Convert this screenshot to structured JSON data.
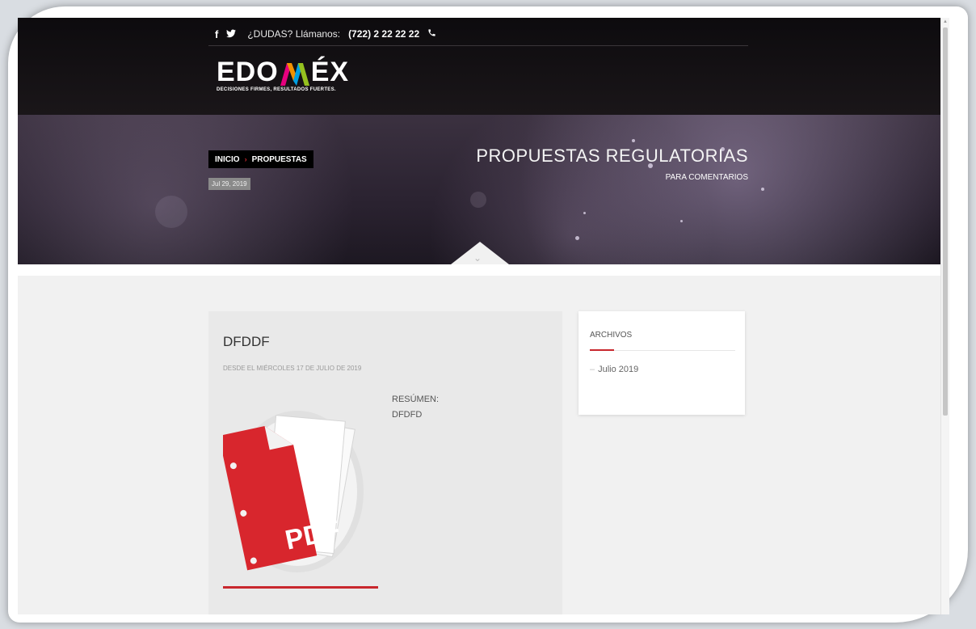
{
  "header": {
    "social_facebook": "f",
    "social_twitter": "𝕥",
    "contact_prompt": "¿DUDAS? Llámanos:",
    "phone": "(722) 2 22 22 22",
    "logo_text_left": "EDO",
    "logo_text_right": "ÉX",
    "logo_tagline": "DECISIONES FIRMES, RESULTADOS FUERTES."
  },
  "hero": {
    "breadcrumb_home": "INICIO",
    "breadcrumb_current": "PROPUESTAS",
    "date": "Jul 29, 2019",
    "title": "PROPUESTAS REGULATORIAS",
    "subtitle": "PARA COMENTARIOS"
  },
  "post": {
    "title": "DFDDF",
    "date_line": "DESDE EL MIÉRCOLES 17 DE JULIO DE 2019",
    "resumen_label": "RESÚMEN:",
    "resumen_text": "DFDFD",
    "pdf_label": "PDF"
  },
  "sidebar": {
    "title": "ARCHIVOS",
    "items": [
      "Julio 2019"
    ]
  },
  "colors": {
    "accent_red": "#c8272d",
    "header_bg": "#0d0b0e"
  }
}
